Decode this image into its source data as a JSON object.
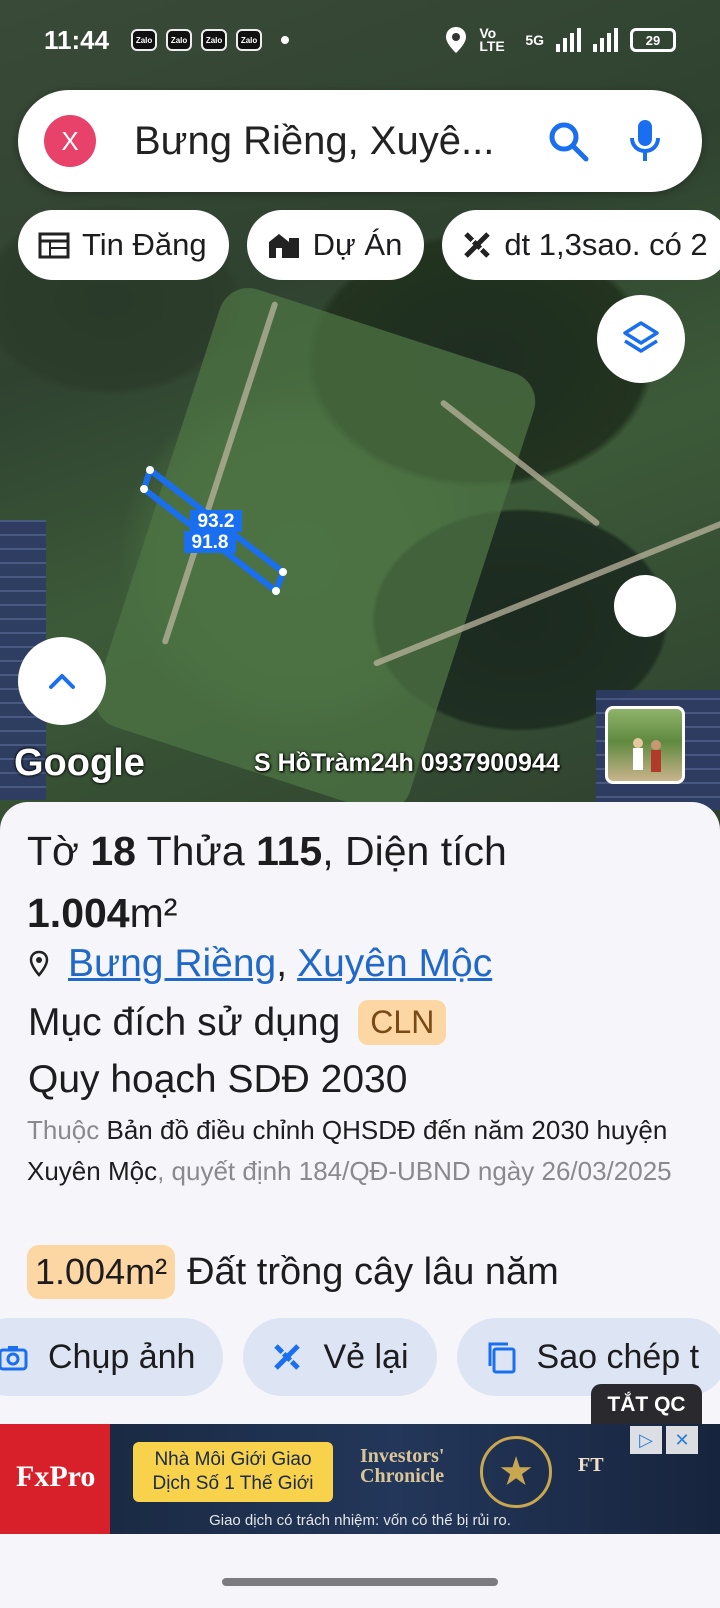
{
  "status_bar": {
    "time": "11:44",
    "notification_apps": [
      "Zalo",
      "Zalo",
      "Zalo",
      "Zalo"
    ],
    "network_label": "Vo LTE",
    "network_type": "5G",
    "battery": "29"
  },
  "search": {
    "close_label": "X",
    "query": "Bưng Riềng, Xuyê..."
  },
  "chips": [
    {
      "label": "Tin Đăng",
      "icon": "calendar-grid-icon"
    },
    {
      "label": "Dự Án",
      "icon": "buildings-icon"
    },
    {
      "label": "dt 1,3sao. có 2",
      "icon": "measure-cross-icon"
    }
  ],
  "map": {
    "plot_labels": {
      "length_top": "93.2",
      "length_bottom": "91.8"
    },
    "google_logo": "Google",
    "watermark": "S HồTràm24h 0937900944",
    "accent_color": "#1a6ff0"
  },
  "info": {
    "title_prefix": "Tờ ",
    "sheet_no": "18",
    "title_mid": " Thửa ",
    "parcel_no": "115",
    "title_suffix": ", Diện tích",
    "area_total": "1.004",
    "area_unit": "m²",
    "location_ward": "Bưng Riềng",
    "location_sep": ",",
    "location_district": "Xuyên Mộc",
    "purpose_label": "Mục đích sử dụng",
    "purpose_code": "CLN",
    "planning_title": "Quy hoạch SDĐ 2030",
    "planning_desc_prefix": "Thuộc ",
    "planning_desc_map": "Bản đồ điều chỉnh QHSDĐ đến năm 2030 huyện Xuyên Mộc",
    "planning_desc_decision": ", quyết định 184/QĐ-UBND ngày 26/03/2025",
    "area_badge": "1.004m²",
    "land_type": "Đất trồng cây lâu năm"
  },
  "actions": [
    {
      "label": "Chụp ảnh",
      "icon": "camera-icon"
    },
    {
      "label": "Vẻ lại",
      "icon": "redraw-icon"
    },
    {
      "label": "Sao chép t",
      "icon": "copy-icon"
    }
  ],
  "ad": {
    "close_tag": "TẮT QC",
    "brand": "FxPro",
    "cta": "Nhà Môi Giới Giao Dịch Số 1 Thế Giới",
    "magazine": "Investors' Chronicle",
    "ft": "FT",
    "disclaimer": "Giao dịch có trách nhiệm: vốn có thể bị rủi ro."
  }
}
